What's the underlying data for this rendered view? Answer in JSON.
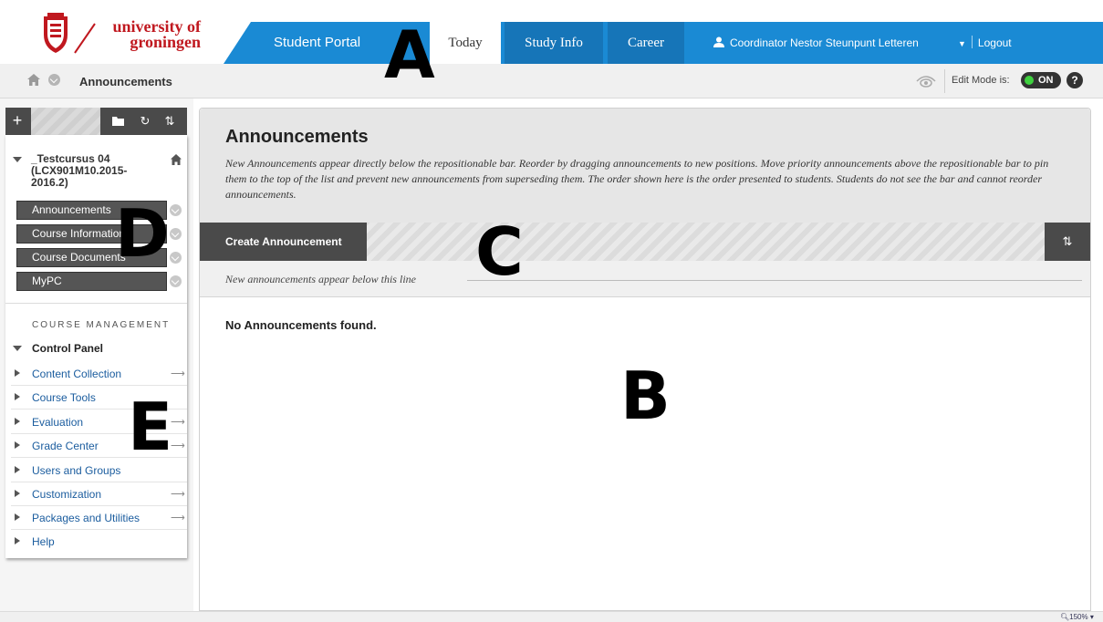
{
  "header": {
    "logo_line1": "university of",
    "logo_line2": "groningen",
    "tabs": [
      {
        "label": "Student Portal"
      },
      {
        "label": "Today"
      },
      {
        "label": "Study Info"
      },
      {
        "label": "Career"
      }
    ],
    "user_name": "Coordinator Nestor Steunpunt Letteren",
    "logout_label": "Logout",
    "brand_blue": "#1a8ad4",
    "brand_red": "#c0181f"
  },
  "breadcrumb": {
    "current": "Announcements",
    "edit_mode_label": "Edit Mode is:",
    "edit_mode_value": "ON",
    "help_label": "?"
  },
  "sidebar": {
    "course_title": "_Testcursus 04 (LCX901M10.2015-2016.2)",
    "menu_items": [
      {
        "label": "Announcements"
      },
      {
        "label": "Course Information"
      },
      {
        "label": "Course Documents"
      },
      {
        "label": "MyPC"
      }
    ],
    "course_management_label": "COURSE MANAGEMENT",
    "control_panel_label": "Control Panel",
    "control_panel_items": [
      {
        "label": "Content Collection",
        "has_arrow": true
      },
      {
        "label": "Course Tools",
        "has_arrow": false
      },
      {
        "label": "Evaluation",
        "has_arrow": true
      },
      {
        "label": "Grade Center",
        "has_arrow": true
      },
      {
        "label": "Users and Groups",
        "has_arrow": false
      },
      {
        "label": "Customization",
        "has_arrow": true
      },
      {
        "label": "Packages and Utilities",
        "has_arrow": true
      },
      {
        "label": "Help",
        "has_arrow": false
      }
    ]
  },
  "main": {
    "title": "Announcements",
    "description": "New Announcements appear directly below the repositionable bar. Reorder by dragging announcements to new positions. Move priority announcements above the repositionable bar to pin them to the top of the list and prevent new announcements from superseding them. The order shown here is the order presented to students. Students do not see the bar and cannot reorder announcements.",
    "create_button_label": "Create Announcement",
    "repositionable_text": "New announcements appear below this line",
    "empty_message": "No Announcements found."
  },
  "annotations": {
    "a": "A",
    "b": "B",
    "c": "C",
    "d": "D",
    "e": "E"
  },
  "status_bar": {
    "zoom": "150%"
  }
}
